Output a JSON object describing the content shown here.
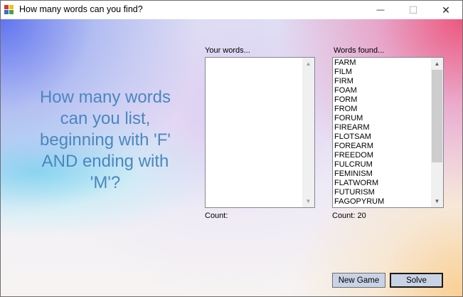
{
  "window": {
    "title": "How many words can you find?",
    "icon": "windows-form-icon",
    "controls": {
      "minimize": "—",
      "maximize": "☐",
      "close": "✕"
    }
  },
  "prompt": {
    "text": "How many words\ncan you list,\nbeginning with 'F'\nAND ending with\n'M'?"
  },
  "your_words": {
    "label": "Your words...",
    "items": [],
    "count_label": "Count:"
  },
  "words_found": {
    "label": "Words found...",
    "items": [
      "FARM",
      "FILM",
      "FIRM",
      "FOAM",
      "FORM",
      "FROM",
      "FORUM",
      "FIREARM",
      "FLOTSAM",
      "FOREARM",
      "FREEDOM",
      "FULCRUM",
      "FEMINISM",
      "FLATWORM",
      "FUTURISM",
      "FAGOPYRUM"
    ],
    "count_label": "Count: 20"
  },
  "buttons": {
    "new_game": "New Game",
    "solve": "Solve"
  },
  "colors": {
    "prompt_text": "#4a87bf",
    "button_face": "#c9d3e6"
  }
}
